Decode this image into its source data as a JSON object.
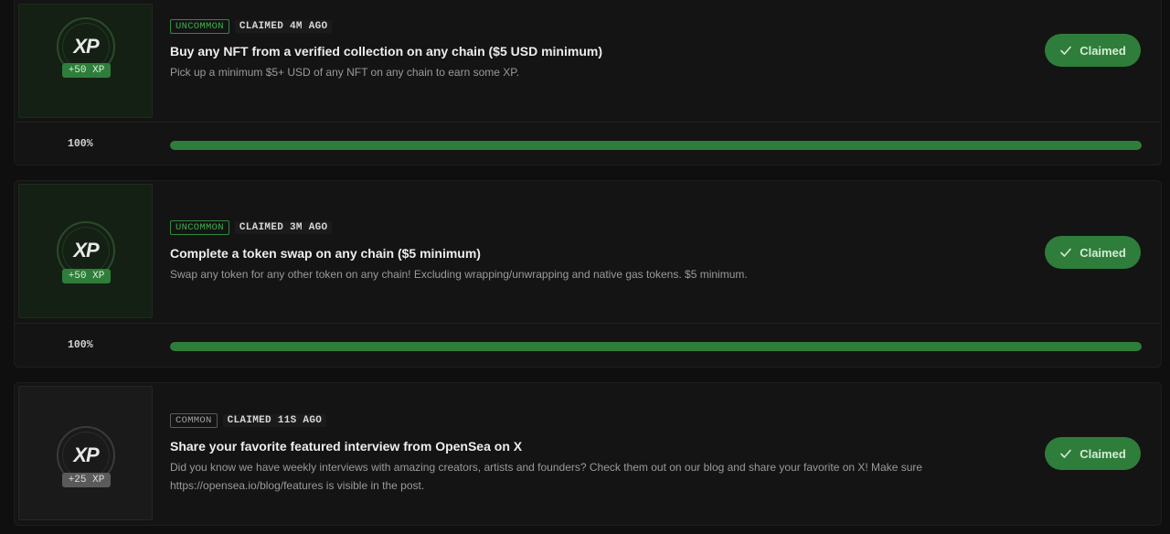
{
  "quests": [
    {
      "rarity": "UNCOMMON",
      "claimed_ago": "CLAIMED 4M AGO",
      "title": "Buy any NFT from a verified collection on any chain ($5 USD minimum)",
      "description": "Pick up a minimum $5+ USD of any NFT on any chain to earn some XP.",
      "xp_logo": "XP",
      "xp_reward": "+50 XP",
      "button_label": "Claimed",
      "progress_label": "100%",
      "progress_fraction": 1.0
    },
    {
      "rarity": "UNCOMMON",
      "claimed_ago": "CLAIMED 3M AGO",
      "title": "Complete a token swap on any chain ($5 minimum)",
      "description": "Swap any token for any other token on any chain! Excluding wrapping/unwrapping and native gas tokens. $5 minimum.",
      "xp_logo": "XP",
      "xp_reward": "+50 XP",
      "button_label": "Claimed",
      "progress_label": "100%",
      "progress_fraction": 1.0
    },
    {
      "rarity": "COMMON",
      "claimed_ago": "CLAIMED 11S AGO",
      "title": "Share your favorite featured interview from OpenSea on X",
      "description": "Did you know we have weekly interviews with amazing creators, artists and founders? Check them out on our blog and share your favorite on X! Make sure https://opensea.io/blog/features is visible in the post.",
      "xp_logo": "XP",
      "xp_reward": "+25 XP",
      "button_label": "Claimed"
    }
  ],
  "colors": {
    "accent_green": "#2f7d3a",
    "uncommon_text": "#3fae4f",
    "common_text": "#a0a0a0",
    "background": "#0f0f0f",
    "card": "#141414"
  },
  "icons": {
    "claimed": "check-icon",
    "reward": "xp-icon"
  }
}
